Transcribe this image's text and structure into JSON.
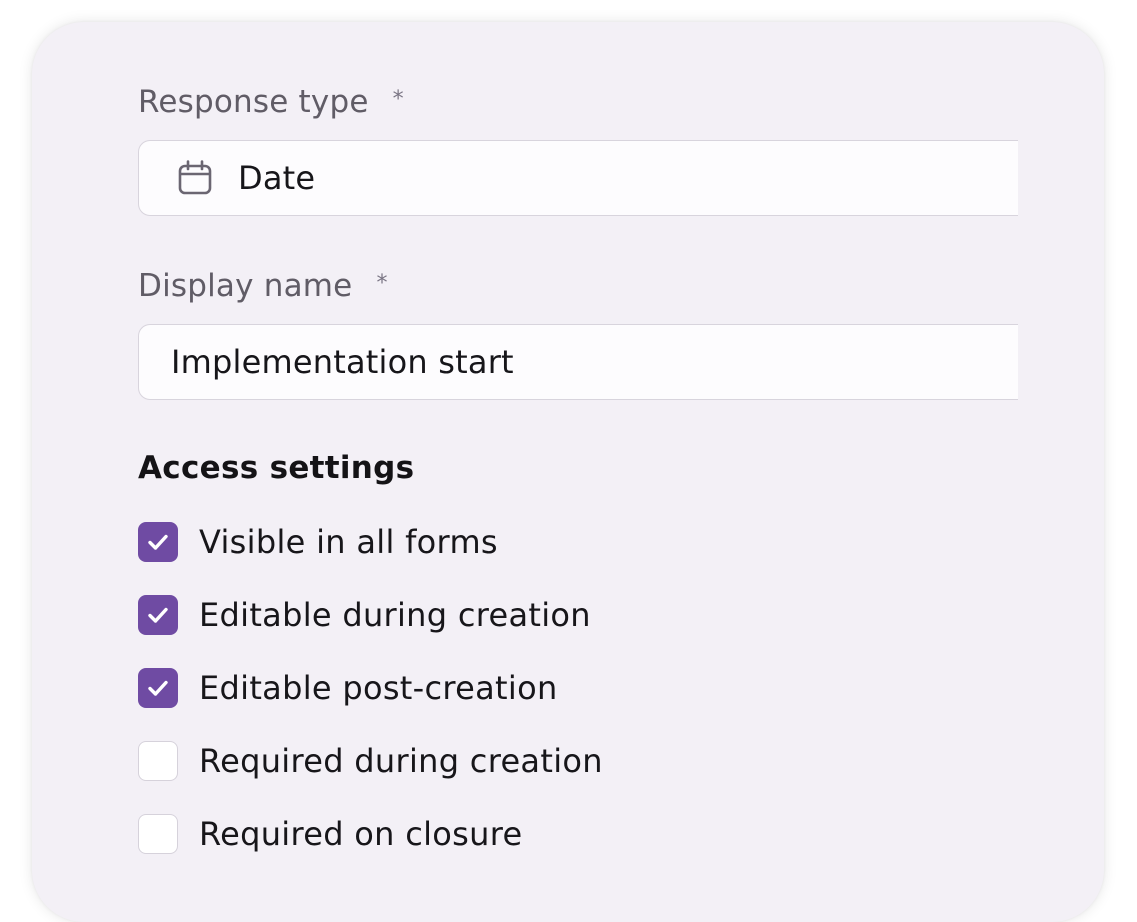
{
  "form": {
    "response_type": {
      "label": "Response type",
      "required_mark": "*",
      "value": "Date",
      "icon": "calendar-icon"
    },
    "display_name": {
      "label": "Display name",
      "required_mark": "*",
      "value": "Implementation start"
    },
    "access_settings": {
      "title": "Access settings",
      "options": [
        {
          "label": "Visible in all forms",
          "checked": true
        },
        {
          "label": "Editable during creation",
          "checked": true
        },
        {
          "label": "Editable post-creation",
          "checked": true
        },
        {
          "label": "Required during creation",
          "checked": false
        },
        {
          "label": "Required on closure",
          "checked": false
        }
      ]
    }
  },
  "colors": {
    "accent": "#6f4ba3",
    "card_background": "#f3f0f6"
  }
}
